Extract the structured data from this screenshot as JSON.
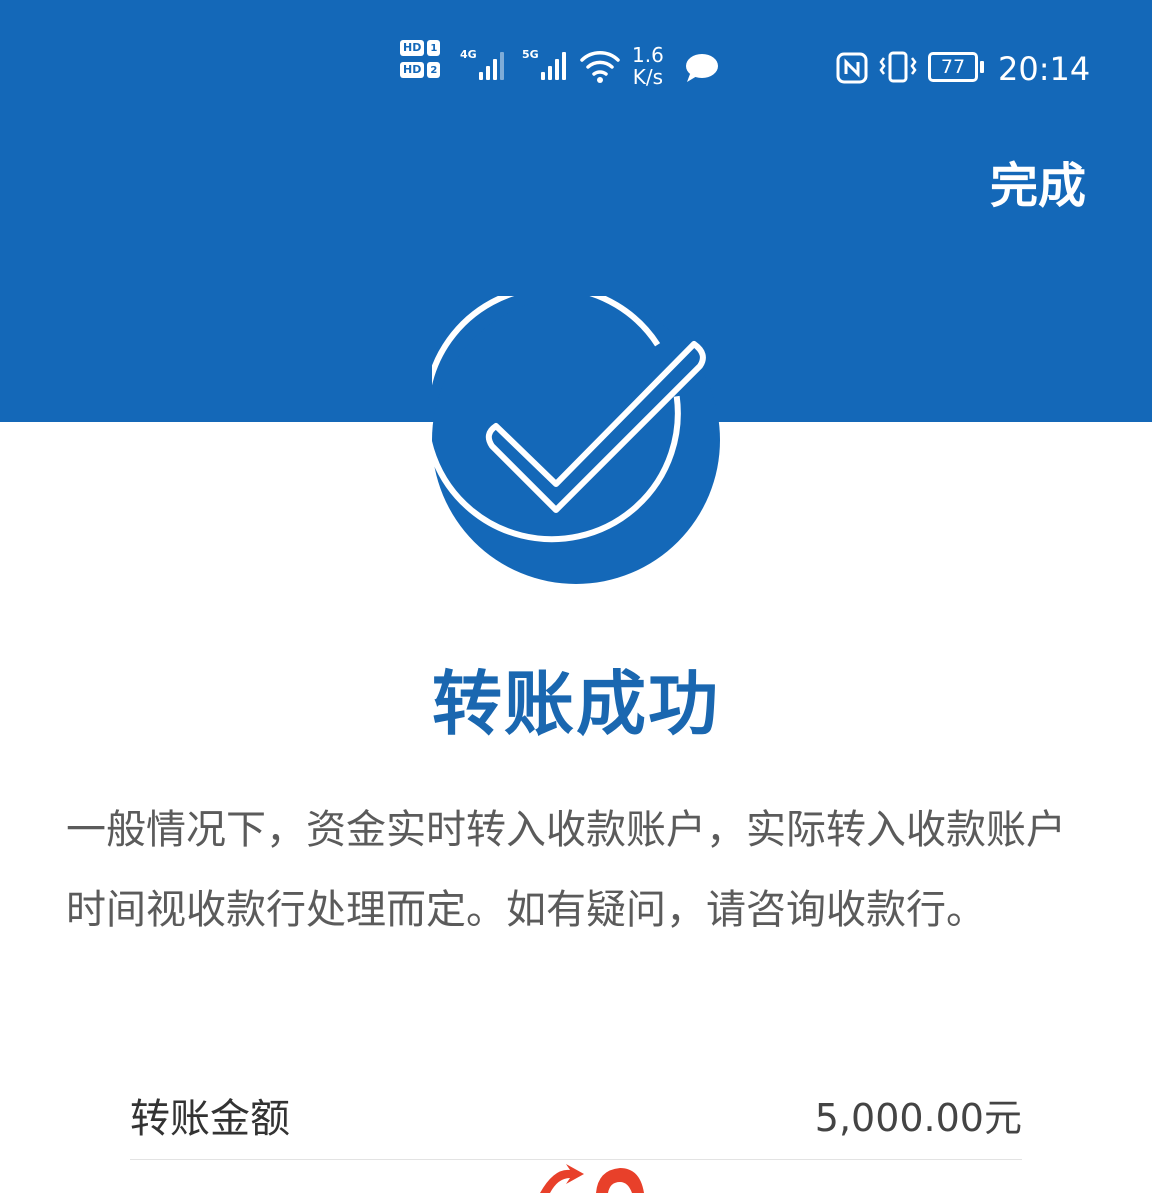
{
  "status_bar": {
    "hd_label": "HD",
    "sim1": "1",
    "sim2": "2",
    "network1": "4G",
    "network2": "5G",
    "speed_value": "1.6",
    "speed_unit": "K/s",
    "battery": "77",
    "time": "20:14"
  },
  "header": {
    "done_label": "完成"
  },
  "result": {
    "title": "转账成功",
    "note": "一般情况下，资金实时转入收款账户，实际转入收款账户时间视收款行处理而定。如有疑问，请咨询收款行。"
  },
  "details": [
    {
      "label": "转账金额",
      "value": "5,000.00元"
    }
  ],
  "colors": {
    "brand_blue": "#1468b8",
    "title_blue": "#1a67b0",
    "note_gray": "#5b5b5b",
    "mark_red": "#e8402a"
  },
  "icons": {
    "hd": "hd-icon",
    "signal": "signal-icon",
    "wifi": "wifi-icon",
    "message": "message-icon",
    "nfc": "nfc-icon",
    "vibrate": "vibrate-icon",
    "battery": "battery-icon",
    "success": "success-check-icon"
  }
}
